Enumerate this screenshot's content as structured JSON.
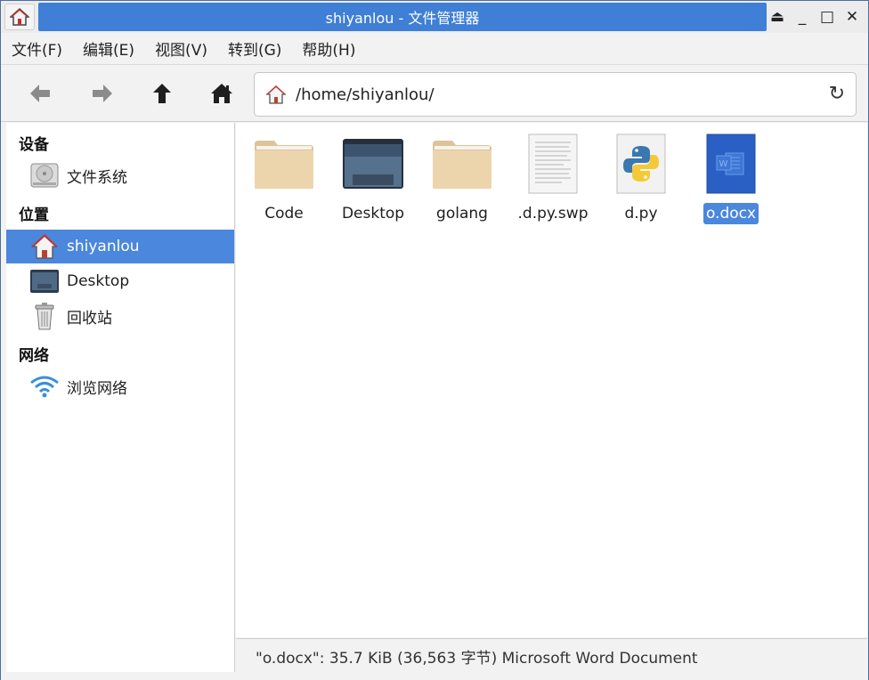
{
  "window": {
    "title": "shiyanlou - 文件管理器",
    "controls": {
      "eject": "⏏",
      "minimize": "_",
      "maximize": "□",
      "close": "✕"
    }
  },
  "menu": [
    "文件(F)",
    "编辑(E)",
    "视图(V)",
    "转到(G)",
    "帮助(H)"
  ],
  "toolbar": {
    "back_icon": "arrow-left-icon",
    "forward_icon": "arrow-right-icon",
    "up_icon": "arrow-up-icon",
    "home_icon": "home-icon",
    "address": "/home/shiyanlou/",
    "reload_icon": "reload-icon"
  },
  "sidebar": {
    "devices_title": "设备",
    "devices": [
      {
        "label": "文件系统",
        "icon": "drive-icon"
      }
    ],
    "places_title": "位置",
    "places": [
      {
        "label": "shiyanlou",
        "icon": "home-folder-icon",
        "selected": true
      },
      {
        "label": "Desktop",
        "icon": "desktop-icon"
      },
      {
        "label": "回收站",
        "icon": "trash-icon"
      }
    ],
    "network_title": "网络",
    "network": [
      {
        "label": "浏览网络",
        "icon": "wifi-icon"
      }
    ]
  },
  "files": [
    {
      "name": "Code",
      "icon": "folder-icon"
    },
    {
      "name": "Desktop",
      "icon": "desktop-folder-icon"
    },
    {
      "name": "golang",
      "icon": "folder-icon"
    },
    {
      "name": ".d.py.swp",
      "icon": "text-file-icon"
    },
    {
      "name": "d.py",
      "icon": "python-file-icon"
    },
    {
      "name": "o.docx",
      "icon": "word-file-icon",
      "selected": true
    }
  ],
  "status": "\"o.docx\": 35.7 KiB (36,563 字节) Microsoft Word Document",
  "colors": {
    "accent": "#4a87dd",
    "titlebar": "#3f7fd6",
    "folder": "#e9d2a8"
  }
}
